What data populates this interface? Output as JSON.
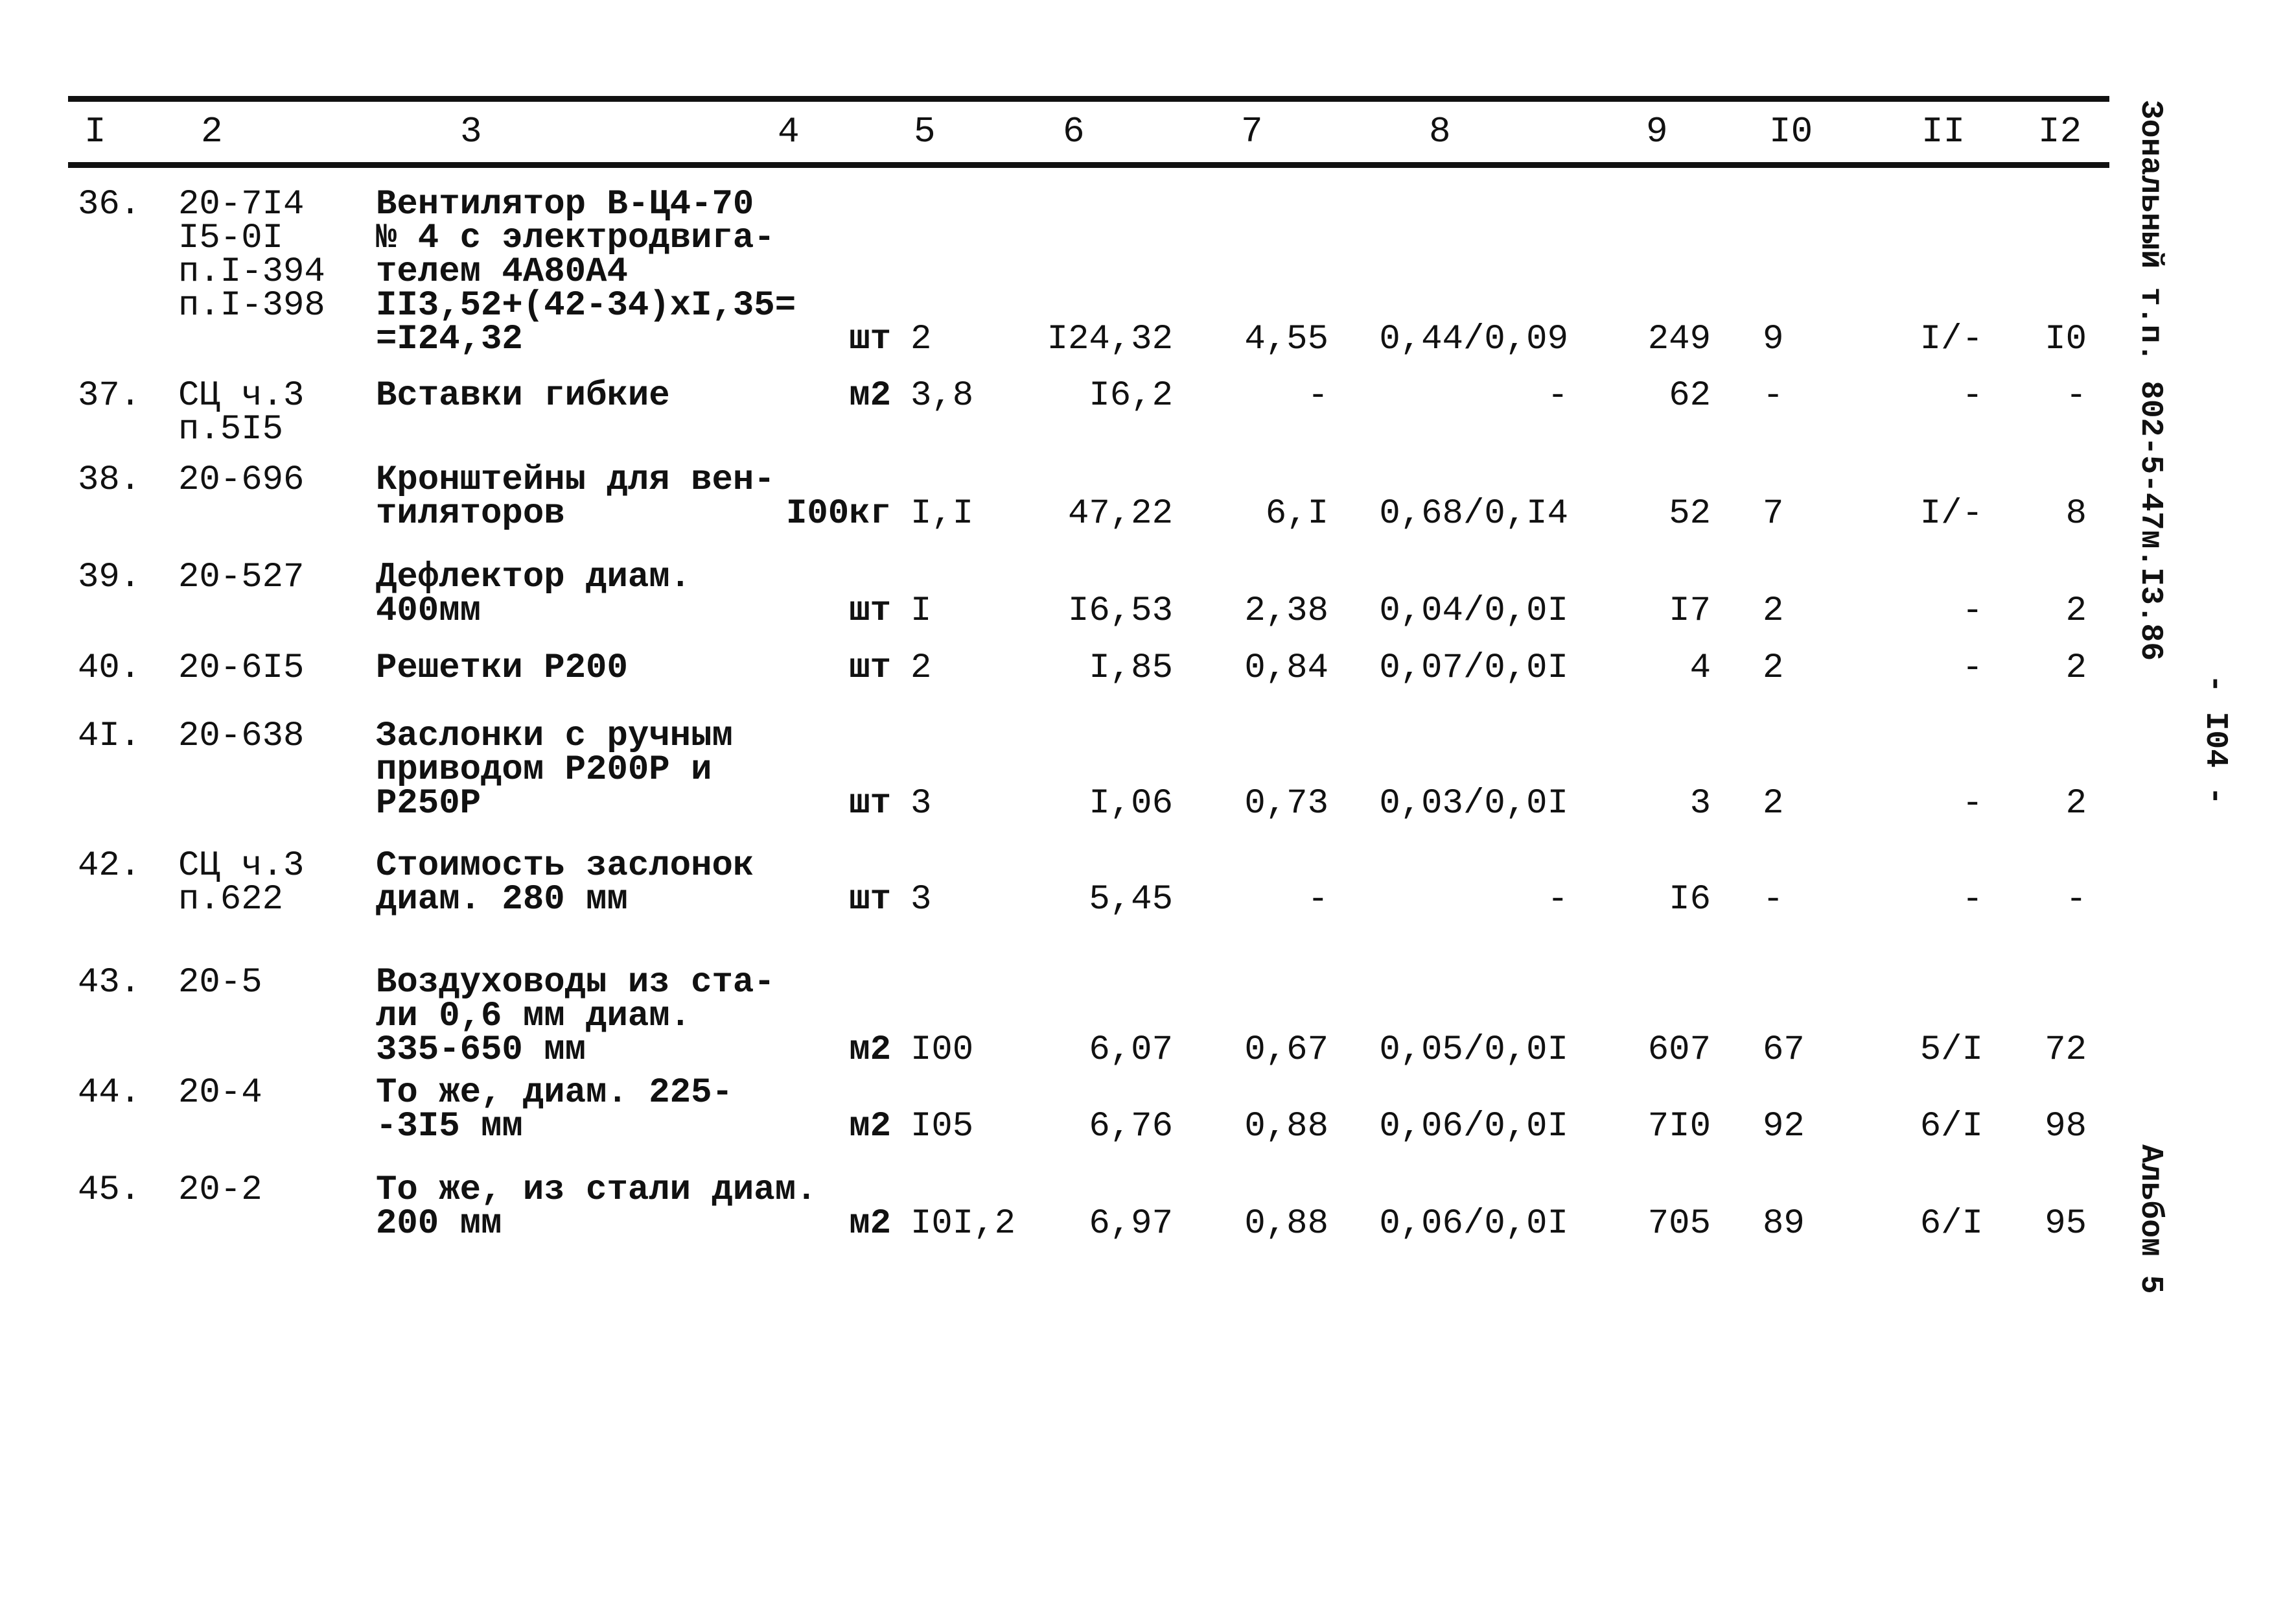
{
  "header": {
    "columns": [
      "I",
      "2",
      "3",
      "4",
      "5",
      "6",
      "7",
      "8",
      "9",
      "I0",
      "II",
      "I2"
    ]
  },
  "rows": [
    {
      "num": "36.",
      "code": "20-7I4\nI5-0I\nп.I-394\nп.I-398",
      "desc": "Вентилятор В-Ц4-70\n№ 4 с электродвига-\nтелем 4А80А4\nII3,52+(42-34)xI,35=\n=I24,32",
      "unit": "шт",
      "qty": "2",
      "c6": "I24,32",
      "c7": "4,55",
      "c8": "0,44/0,09",
      "c9": "249",
      "c10": "9",
      "c11": "I/-",
      "c12": "I0"
    },
    {
      "num": "37.",
      "code": "СЦ ч.3\nп.5I5",
      "desc": "Вставки гибкие",
      "unit": "м2",
      "qty": "3,8",
      "c6": "I6,2",
      "c7": "-",
      "c8": "-",
      "c9": "62",
      "c10": "-",
      "c11": "-",
      "c12": "-"
    },
    {
      "num": "38.",
      "code": "20-696",
      "desc": "Кронштейны для вен-\nтиляторов",
      "unit": "I00кг",
      "qty": "I,I",
      "c6": "47,22",
      "c7": "6,I",
      "c8": "0,68/0,I4",
      "c9": "52",
      "c10": "7",
      "c11": "I/-",
      "c12": "8"
    },
    {
      "num": "39.",
      "code": "20-527",
      "desc": "Дефлектор диам.\n400мм",
      "unit": "шт",
      "qty": "I",
      "c6": "I6,53",
      "c7": "2,38",
      "c8": "0,04/0,0I",
      "c9": "I7",
      "c10": "2",
      "c11": "-",
      "c12": "2"
    },
    {
      "num": "40.",
      "code": "20-6I5",
      "desc": "Решетки Р200",
      "unit": "шт",
      "qty": "2",
      "c6": "I,85",
      "c7": "0,84",
      "c8": "0,07/0,0I",
      "c9": "4",
      "c10": "2",
      "c11": "-",
      "c12": "2"
    },
    {
      "num": "4I.",
      "code": "20-638",
      "desc": "Заслонки с ручным\nприводом Р200Р и\nР250Р",
      "unit": "шт",
      "qty": "3",
      "c6": "I,06",
      "c7": "0,73",
      "c8": "0,03/0,0I",
      "c9": "3",
      "c10": "2",
      "c11": "-",
      "c12": "2"
    },
    {
      "num": "42.",
      "code": "СЦ ч.3\nп.622",
      "desc": "Стоимость заслонок\nдиам. 280 мм",
      "unit": "шт",
      "qty": "3",
      "c6": "5,45",
      "c7": "-",
      "c8": "-",
      "c9": "I6",
      "c10": "-",
      "c11": "-",
      "c12": "-"
    },
    {
      "num": "43.",
      "code": "20-5",
      "desc": "Воздуховоды из ста-\nли 0,6 мм диам.\n335-650 мм",
      "unit": "м2",
      "qty": "I00",
      "c6": "6,07",
      "c7": "0,67",
      "c8": "0,05/0,0I",
      "c9": "607",
      "c10": "67",
      "c11": "5/I",
      "c12": "72"
    },
    {
      "num": "44.",
      "code": "20-4",
      "desc": "То же, диам. 225-\n-3I5 мм",
      "unit": "м2",
      "qty": "I05",
      "c6": "6,76",
      "c7": "0,88",
      "c8": "0,06/0,0I",
      "c9": "7I0",
      "c10": "92",
      "c11": "6/I",
      "c12": "98"
    },
    {
      "num": "45.",
      "code": "20-2",
      "desc": "То же, из стали диам.\n200 мм",
      "unit": "м2",
      "qty": "I0I,2",
      "c6": "6,97",
      "c7": "0,88",
      "c8": "0,06/0,0I",
      "c9": "705",
      "c10": "89",
      "c11": "6/I",
      "c12": "95"
    }
  ],
  "margin": {
    "doc_code": "Зональный т.п. 802-5-47м.I3.86",
    "page_number": "- I04 -",
    "album": "Альбом 5"
  }
}
